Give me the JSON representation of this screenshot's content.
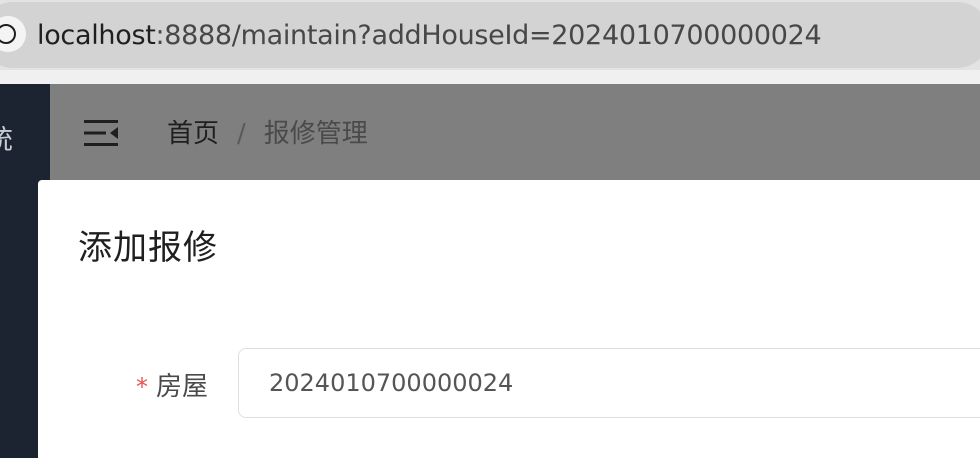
{
  "browser": {
    "url_host": "localhost",
    "url_rest": ":8888/maintain?addHouseId=2024010700000024"
  },
  "sidebar": {
    "title_fragment": "统"
  },
  "header": {
    "breadcrumb": {
      "home": "首页",
      "separator": "/",
      "current": "报修管理"
    }
  },
  "dialog": {
    "title": "添加报修",
    "fields": {
      "house": {
        "required_mark": "*",
        "label": "房屋",
        "value": "2024010700000024"
      }
    }
  },
  "icons": {
    "site_info": "site-info-icon",
    "menu_toggle": "menu-fold-icon"
  },
  "colors": {
    "sidebar_bg": "#1d2431",
    "overlay_header": "#7f7f7f",
    "required": "#e55353"
  }
}
